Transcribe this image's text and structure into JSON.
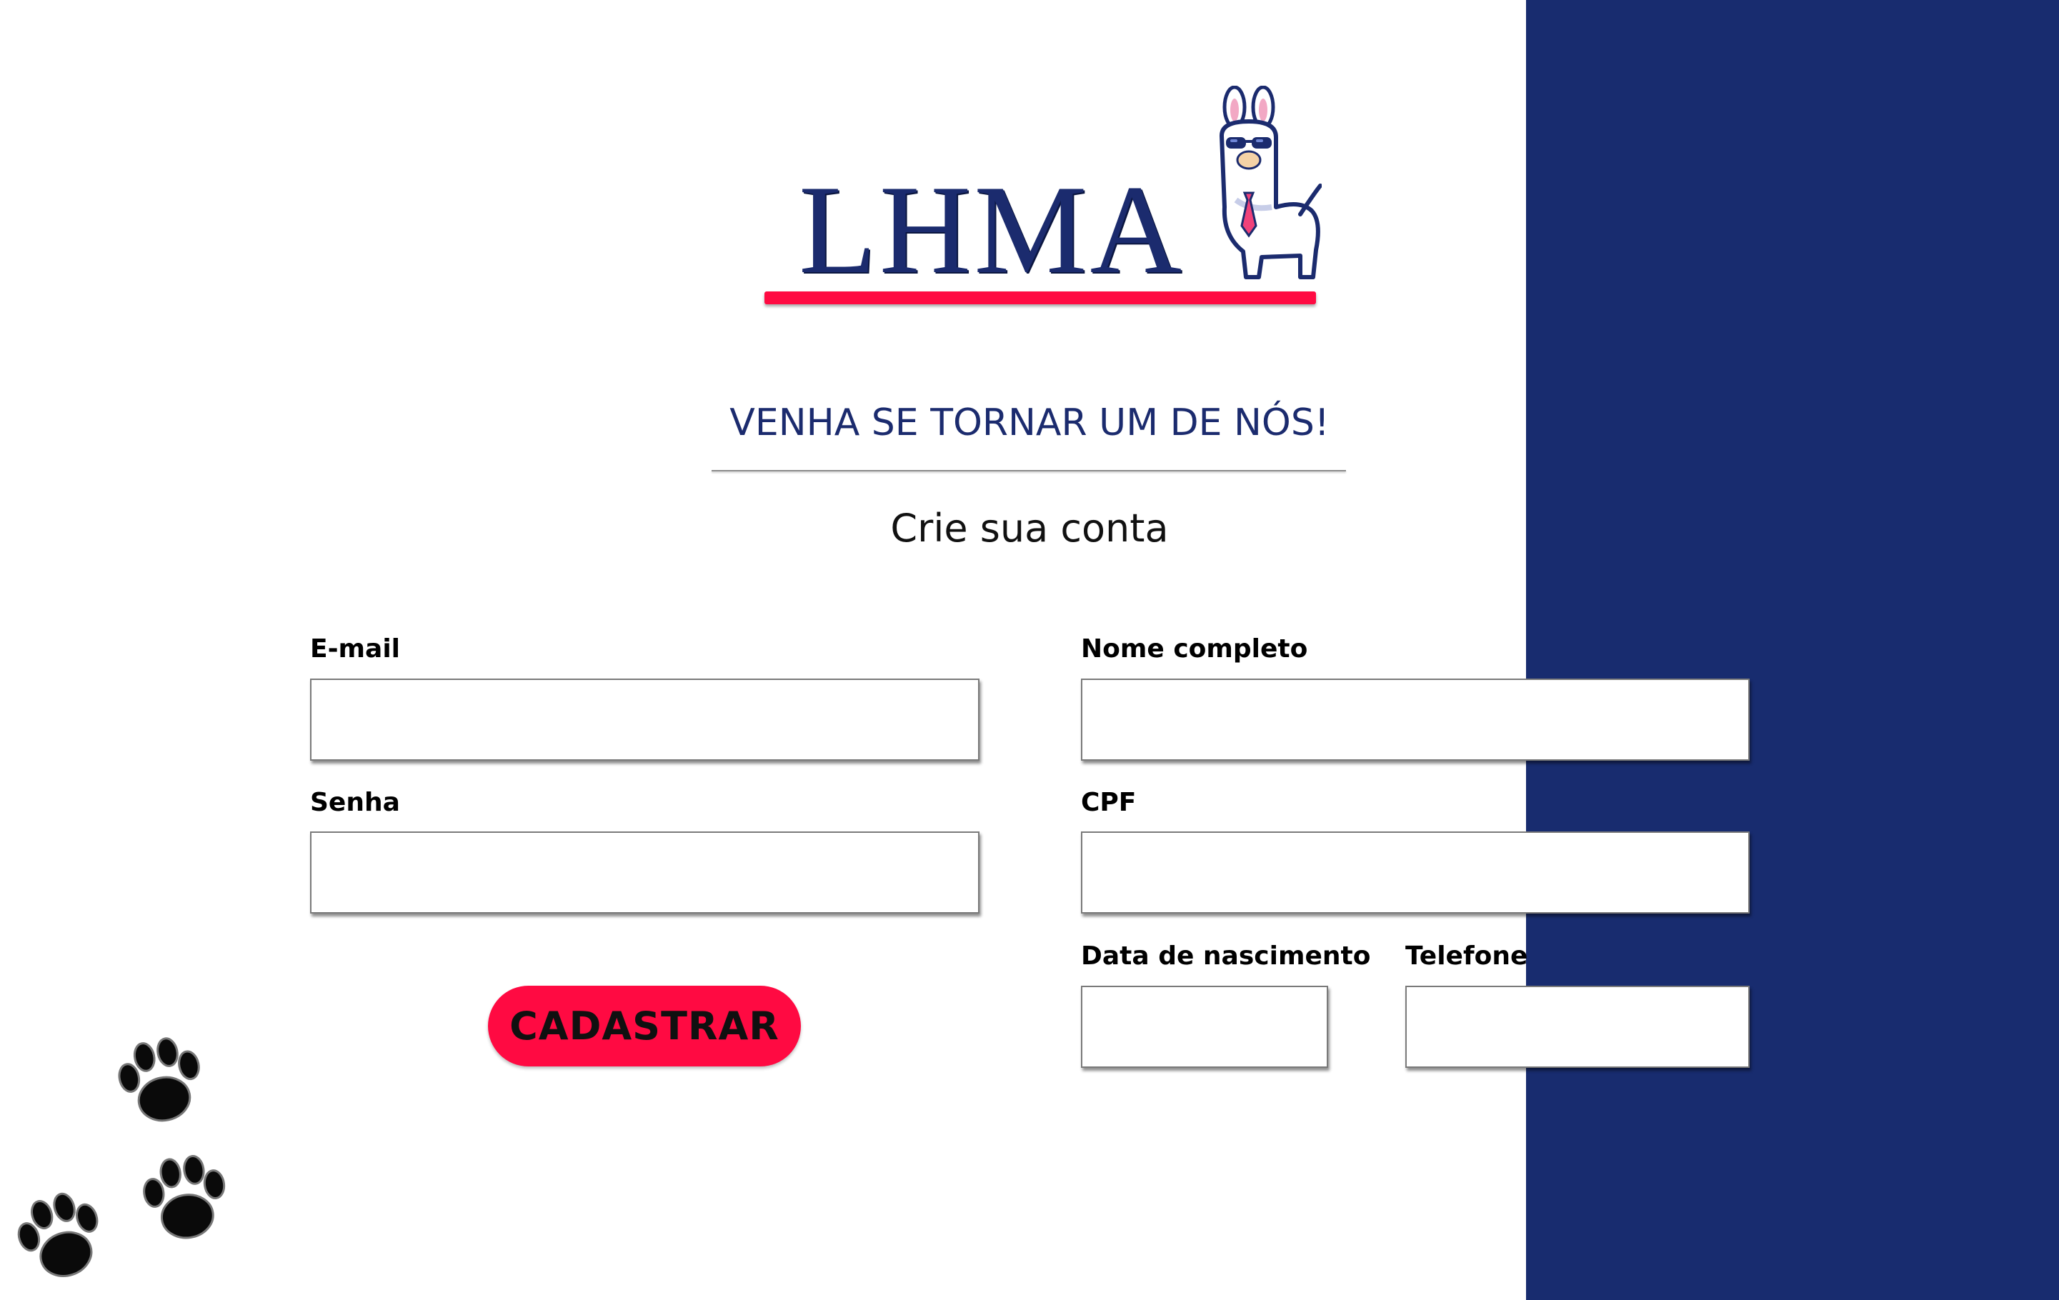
{
  "brand": {
    "logo_text": "LHMA",
    "accent_color": "#ff0a42",
    "primary_color": "#182c6f"
  },
  "header": {
    "headline": "VENHA SE TORNAR UM DE NÓS!",
    "subheadline": "Crie sua conta"
  },
  "form": {
    "email": {
      "label": "E-mail",
      "value": "",
      "placeholder": ""
    },
    "password": {
      "label": "Senha",
      "value": "",
      "placeholder": ""
    },
    "full_name": {
      "label": "Nome completo",
      "value": "",
      "placeholder": ""
    },
    "cpf": {
      "label": "CPF",
      "value": "",
      "placeholder": ""
    },
    "birth_date": {
      "label": "Data de nascimento",
      "value": "",
      "placeholder": ""
    },
    "phone": {
      "label": "Telefone",
      "value": "",
      "placeholder": ""
    },
    "submit_label": "CADASTRAR"
  },
  "decorations": {
    "icons": [
      "llama-mascot-icon",
      "paw-print-icon"
    ]
  }
}
